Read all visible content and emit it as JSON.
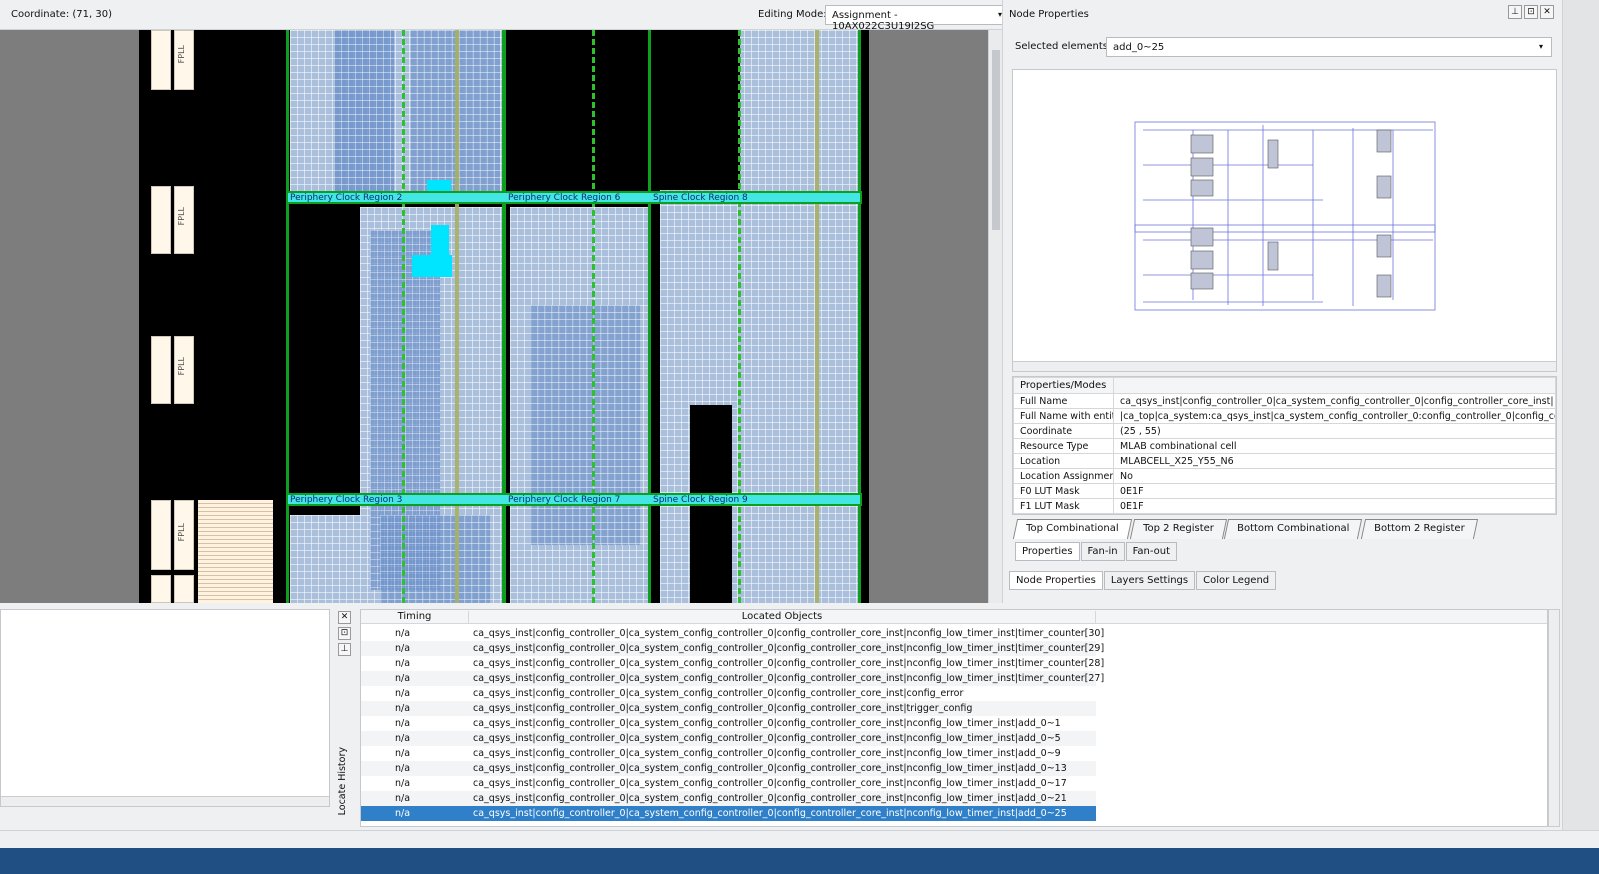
{
  "toolbar": {
    "coordinate": "Coordinate: (71, 30)",
    "editing_mode_label": "Editing Mode:",
    "editing_mode_value": "Assignment - 10AX022C3U19I2SG"
  },
  "chip": {
    "fpll_label": "FPLL",
    "regions": [
      "Periphery Clock Region 2",
      "Periphery Clock Region 6",
      "Spine Clock Region 8",
      "Periphery Clock Region 3",
      "Periphery Clock Region 7",
      "Spine Clock Region 9"
    ]
  },
  "node_properties": {
    "title": "Node Properties",
    "selected_label": "Selected elements:",
    "selected_value": "add_0~25",
    "table_header": "Properties/Modes",
    "rows": [
      {
        "k": "Full Name",
        "v": "ca_qsys_inst|config_controller_0|ca_system_config_controller_0|config_controller_core_inst|"
      },
      {
        "k": "Full Name with entity",
        "v": "|ca_top|ca_system:ca_qsys_inst|ca_system_config_controller_0:config_controller_0|config_co"
      },
      {
        "k": "Coordinate",
        "v": "(25 , 55)"
      },
      {
        "k": "Resource Type",
        "v": "MLAB combinational cell"
      },
      {
        "k": "Location",
        "v": "MLABCELL_X25_Y55_N6"
      },
      {
        "k": "Location Assignment",
        "v": "No"
      },
      {
        "k": "F0 LUT Mask",
        "v": "0E1F"
      },
      {
        "k": "F1 LUT Mask",
        "v": "0E1F"
      }
    ],
    "mode_tabs": [
      "Top Combinational",
      "Top 2 Register",
      "Bottom Combinational",
      "Bottom 2 Register"
    ],
    "sub_tabs": [
      "Properties",
      "Fan-in",
      "Fan-out"
    ],
    "bottom_tabs": [
      "Node Properties",
      "Layers Settings",
      "Color Legend"
    ]
  },
  "locate": {
    "history_label": "Locate History",
    "col_timing": "Timing",
    "col_objects": "Located Objects",
    "rows": [
      {
        "t": "n/a",
        "o": "ca_qsys_inst|config_controller_0|ca_system_config_controller_0|config_controller_core_inst|nconfig_low_timer_inst|timer_counter[30]"
      },
      {
        "t": "n/a",
        "o": "ca_qsys_inst|config_controller_0|ca_system_config_controller_0|config_controller_core_inst|nconfig_low_timer_inst|timer_counter[29]"
      },
      {
        "t": "n/a",
        "o": "ca_qsys_inst|config_controller_0|ca_system_config_controller_0|config_controller_core_inst|nconfig_low_timer_inst|timer_counter[28]"
      },
      {
        "t": "n/a",
        "o": "ca_qsys_inst|config_controller_0|ca_system_config_controller_0|config_controller_core_inst|nconfig_low_timer_inst|timer_counter[27]"
      },
      {
        "t": "n/a",
        "o": "ca_qsys_inst|config_controller_0|ca_system_config_controller_0|config_controller_core_inst|config_error"
      },
      {
        "t": "n/a",
        "o": "ca_qsys_inst|config_controller_0|ca_system_config_controller_0|config_controller_core_inst|trigger_config"
      },
      {
        "t": "n/a",
        "o": "ca_qsys_inst|config_controller_0|ca_system_config_controller_0|config_controller_core_inst|nconfig_low_timer_inst|add_0~1"
      },
      {
        "t": "n/a",
        "o": "ca_qsys_inst|config_controller_0|ca_system_config_controller_0|config_controller_core_inst|nconfig_low_timer_inst|add_0~5"
      },
      {
        "t": "n/a",
        "o": "ca_qsys_inst|config_controller_0|ca_system_config_controller_0|config_controller_core_inst|nconfig_low_timer_inst|add_0~9"
      },
      {
        "t": "n/a",
        "o": "ca_qsys_inst|config_controller_0|ca_system_config_controller_0|config_controller_core_inst|nconfig_low_timer_inst|add_0~13"
      },
      {
        "t": "n/a",
        "o": "ca_qsys_inst|config_controller_0|ca_system_config_controller_0|config_controller_core_inst|nconfig_low_timer_inst|add_0~17"
      },
      {
        "t": "n/a",
        "o": "ca_qsys_inst|config_controller_0|ca_system_config_controller_0|config_controller_core_inst|nconfig_low_timer_inst|add_0~21"
      },
      {
        "t": "n/a",
        "o": "ca_qsys_inst|config_controller_0|ca_system_config_controller_0|config_controller_core_inst|nconfig_low_timer_inst|add_0~25"
      }
    ]
  },
  "icons": {
    "pin": "pin-icon",
    "float": "float-icon",
    "close": "close-icon"
  },
  "colors": {
    "clock_region_border": "#0f9f20",
    "clock_region_bar": "#43e6e2",
    "selected_row": "#2f80c8",
    "taskbar": "#1f4f83"
  }
}
